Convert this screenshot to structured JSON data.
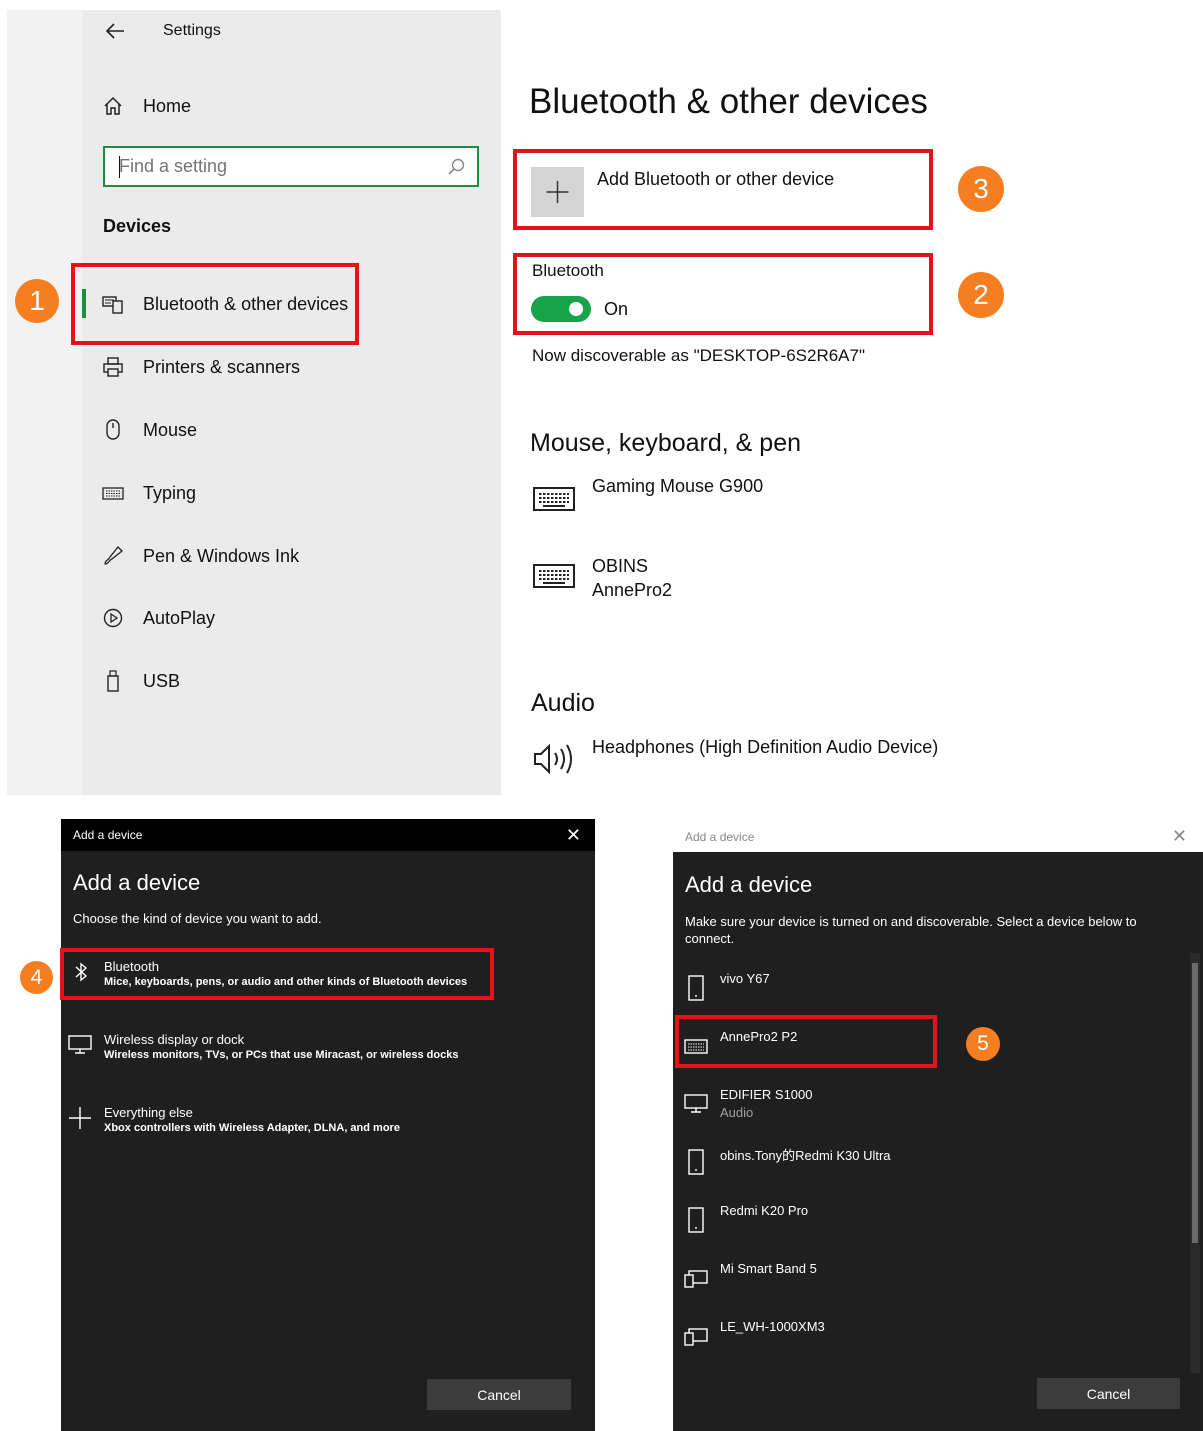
{
  "settings": {
    "window_title": "Settings",
    "home_label": "Home",
    "search_placeholder": "Find a setting",
    "section_label": "Devices",
    "nav_items": [
      {
        "label": "Bluetooth & other devices",
        "icon": "bluetooth-devices-icon"
      },
      {
        "label": "Printers & scanners",
        "icon": "printer-icon"
      },
      {
        "label": "Mouse",
        "icon": "mouse-icon"
      },
      {
        "label": "Typing",
        "icon": "keyboard-icon"
      },
      {
        "label": "Pen & Windows Ink",
        "icon": "pen-icon"
      },
      {
        "label": "AutoPlay",
        "icon": "autoplay-icon"
      },
      {
        "label": "USB",
        "icon": "usb-icon"
      }
    ]
  },
  "main": {
    "page_title": "Bluetooth & other devices",
    "add_device_label": "Add Bluetooth or other device",
    "bluetooth_label": "Bluetooth",
    "toggle_state": "On",
    "discoverable_text": "Now discoverable as \"DESKTOP-6S2R6A7\"",
    "mouse_section_title": "Mouse, keyboard, & pen",
    "mouse_devices": [
      {
        "name": "Gaming Mouse G900",
        "sub": ""
      },
      {
        "name": "OBINS",
        "sub": "AnnePro2"
      }
    ],
    "audio_section_title": "Audio",
    "audio_devices": [
      {
        "name": "Headphones (High Definition Audio Device)"
      }
    ]
  },
  "badges": [
    "1",
    "2",
    "3",
    "4",
    "5"
  ],
  "dialog1": {
    "title_bar": "Add a device",
    "heading": "Add a device",
    "subtitle": "Choose the kind of device you want to add.",
    "options": [
      {
        "title": "Bluetooth",
        "desc": "Mice, keyboards, pens, or audio and other kinds of Bluetooth devices",
        "icon": "bluetooth-icon"
      },
      {
        "title": "Wireless display or dock",
        "desc": "Wireless monitors, TVs, or PCs that use Miracast, or wireless docks",
        "icon": "monitor-icon"
      },
      {
        "title": "Everything else",
        "desc": "Xbox controllers with Wireless Adapter, DLNA, and more",
        "icon": "plus-icon"
      }
    ],
    "cancel_label": "Cancel"
  },
  "dialog2": {
    "title_bar": "Add a device",
    "heading": "Add a device",
    "subtitle": "Make sure your device is turned on and discoverable. Select a device below to connect.",
    "devices": [
      {
        "name": "vivo Y67",
        "sub": "",
        "icon": "phone-icon"
      },
      {
        "name": "AnnePro2 P2",
        "sub": "",
        "icon": "keyboard-icon"
      },
      {
        "name": "EDIFIER S1000",
        "sub": "Audio",
        "icon": "monitor-icon"
      },
      {
        "name": "obins.Tony的Redmi K30 Ultra",
        "sub": "",
        "icon": "phone-icon"
      },
      {
        "name": "Redmi K20 Pro",
        "sub": "",
        "icon": "phone-icon"
      },
      {
        "name": "Mi Smart Band 5",
        "sub": "",
        "icon": "devices-icon"
      },
      {
        "name": "LE_WH-1000XM3",
        "sub": "",
        "icon": "devices-icon"
      }
    ],
    "cancel_label": "Cancel"
  },
  "colors": {
    "highlight_red": "#e4131a",
    "badge_orange": "#f57e20",
    "toggle_green": "#16a34a",
    "dialog_bg": "#1f1f1f"
  }
}
